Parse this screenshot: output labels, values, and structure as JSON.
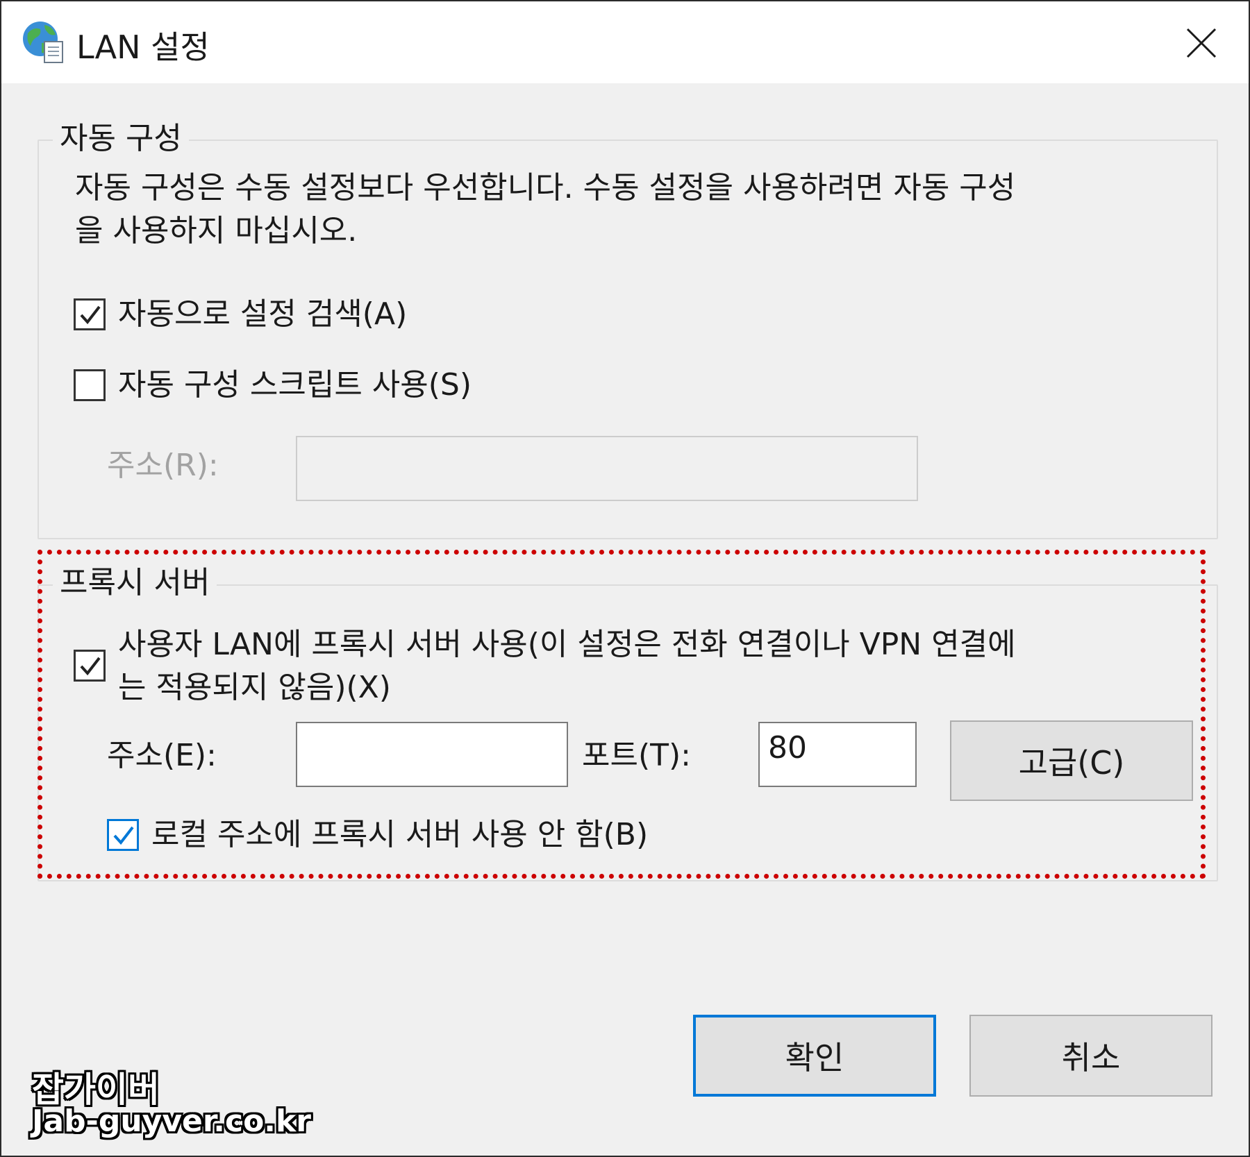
{
  "window": {
    "title": "LAN 설정"
  },
  "auto_config": {
    "legend": "자동 구성",
    "description_line1": "자동 구성은 수동 설정보다 우선합니다. 수동 설정을 사용하려면 자동 구성",
    "description_line2": "을 사용하지 마십시오.",
    "detect_settings": {
      "label": "자동으로 설정 검색(A)",
      "checked": true
    },
    "use_script": {
      "label": "자동 구성 스크립트 사용(S)",
      "checked": false
    },
    "address": {
      "label": "주소(R):",
      "value": "",
      "enabled": false
    }
  },
  "proxy": {
    "legend": "프록시 서버",
    "use_proxy": {
      "label_line1": "사용자 LAN에 프록시 서버 사용(이 설정은 전화 연결이나 VPN 연결에",
      "label_line2": "는 적용되지 않음)(X)",
      "checked": true
    },
    "address": {
      "label": "주소(E):",
      "value": ""
    },
    "port": {
      "label": "포트(T):",
      "value": "80"
    },
    "advanced_label": "고급(C)",
    "bypass_local": {
      "label": "로컬 주소에 프록시 서버 사용 안 함(B)",
      "checked": true
    }
  },
  "buttons": {
    "ok_label": "확인",
    "cancel_label": "취소"
  },
  "watermark": {
    "line1": "잡가이버",
    "line2": "Jab-guyver.co.kr"
  },
  "colors": {
    "highlight": "#cc0000",
    "accent": "#0078d7"
  }
}
